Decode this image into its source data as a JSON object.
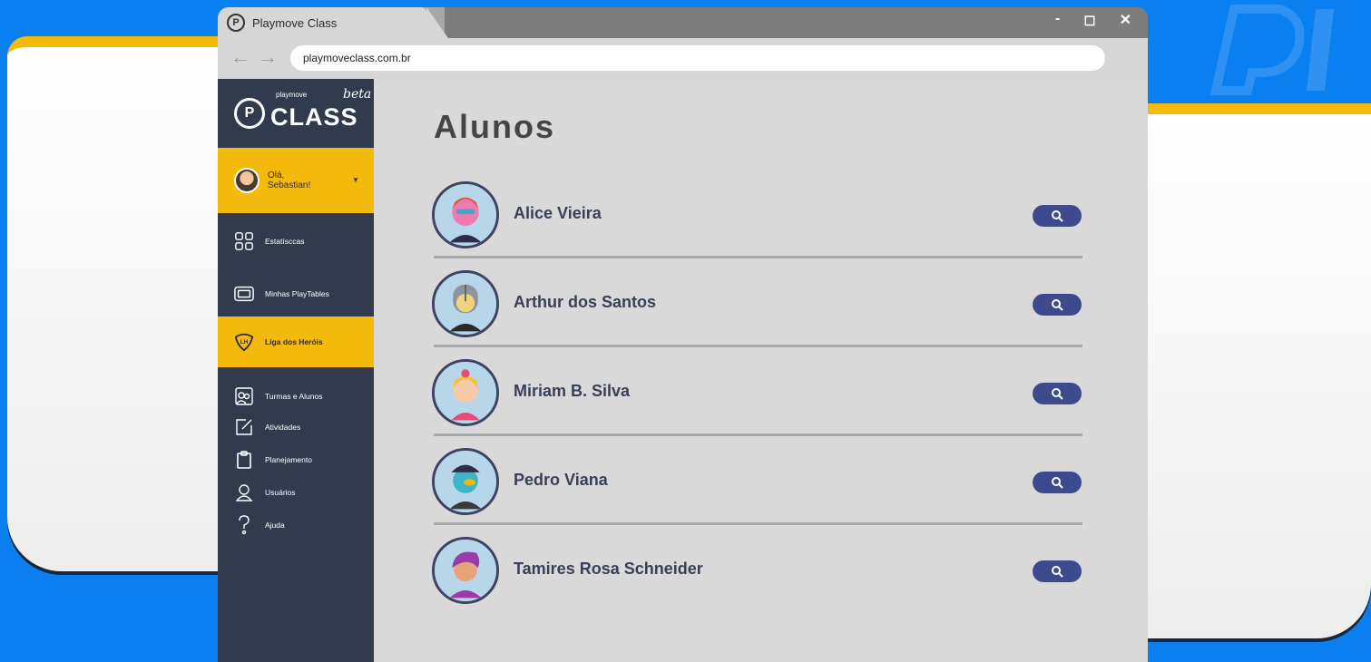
{
  "browser": {
    "tab_title": "Playmove Class",
    "url": "playmoveclass.com.br",
    "controls": {
      "minimize": "-",
      "maximize": "◻",
      "close": "✕"
    },
    "nav": {
      "back": "←",
      "forward": "→"
    }
  },
  "brand": {
    "small": "playmove",
    "name": "CLASS",
    "tag": "beta"
  },
  "user": {
    "greeting_line1": "Olá,",
    "greeting_line2": "Sebastian!",
    "caret": "▼"
  },
  "sidebar": {
    "items": [
      {
        "label": "Estatísccas",
        "icon": "grid-icon"
      },
      {
        "label": "Minhas PlayTables",
        "icon": "tablet-icon"
      },
      {
        "label": "Liga dos Heróis",
        "icon": "shield-icon",
        "active": true
      },
      {
        "label": "Turmas e Alunos",
        "icon": "group-icon"
      },
      {
        "label": "Atividades",
        "icon": "edit-icon"
      },
      {
        "label": "Planejamento",
        "icon": "clipboard-icon"
      },
      {
        "label": "Usuários",
        "icon": "user-icon"
      },
      {
        "label": "Ajuda",
        "icon": "question-icon"
      }
    ]
  },
  "main": {
    "title": "Alunos",
    "students": [
      {
        "name": "Alice Vieira",
        "avatar_color": "#e2553a"
      },
      {
        "name": "Arthur dos Santos",
        "avatar_color": "#8e949c"
      },
      {
        "name": "Miriam B. Silva",
        "avatar_color": "#f0c43a"
      },
      {
        "name": "Pedro Viana",
        "avatar_color": "#3bb7c9"
      },
      {
        "name": "Tamires Rosa Schneider",
        "avatar_color": "#9b3aa8"
      }
    ]
  },
  "colors": {
    "background": "#0a7ff0",
    "accent_yellow": "#f3b90b",
    "sidebar": "#323a4e",
    "button": "#3e4a8e"
  }
}
